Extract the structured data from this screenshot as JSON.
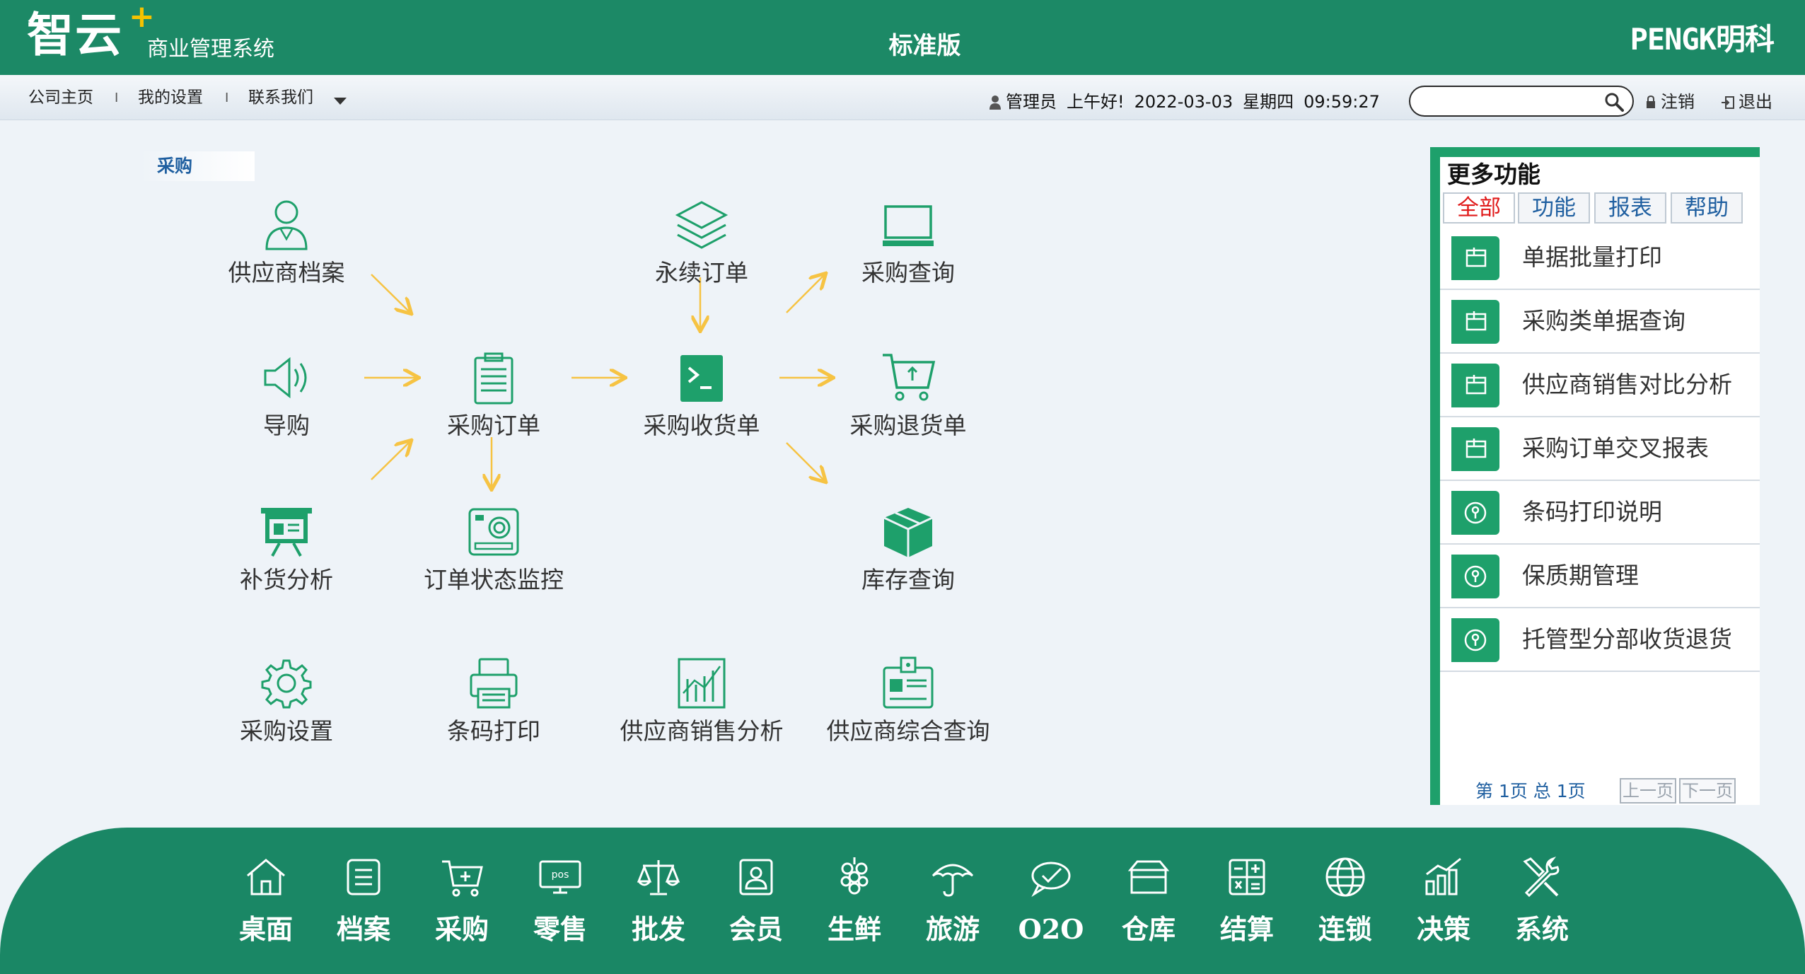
{
  "header": {
    "logo_main": "智云",
    "logo_plus": "+",
    "logo_sub": "商业管理系统",
    "edition": "标准版",
    "brand": "PENGK明科"
  },
  "nav": {
    "links": [
      "公司主页",
      "我的设置",
      "联系我们"
    ],
    "separators": [
      "I",
      "I"
    ],
    "user_role": "管理员",
    "greeting": "上午好!",
    "date": "2022-03-03",
    "weekday": "星期四",
    "time": "09:59:27",
    "search_value": "",
    "logout_label": "注销",
    "exit_label": "退出"
  },
  "section": {
    "title": "采购"
  },
  "flow": {
    "items": [
      {
        "label": "供应商档案",
        "icon": "person-icon"
      },
      {
        "label": "永续订单",
        "icon": "layers-icon"
      },
      {
        "label": "采购查询",
        "icon": "monitor-icon"
      },
      {
        "label": "导购",
        "icon": "speaker-icon"
      },
      {
        "label": "采购订单",
        "icon": "clipboard-icon"
      },
      {
        "label": "采购收货单",
        "icon": "terminal-icon"
      },
      {
        "label": "采购退货单",
        "icon": "cart-return-icon"
      },
      {
        "label": "补货分析",
        "icon": "presentation-icon"
      },
      {
        "label": "订单状态监控",
        "icon": "camera-icon"
      },
      {
        "label": "库存查询",
        "icon": "box-icon"
      },
      {
        "label": "采购设置",
        "icon": "gear-icon"
      },
      {
        "label": "条码打印",
        "icon": "printer-icon"
      },
      {
        "label": "供应商销售分析",
        "icon": "chart-icon"
      },
      {
        "label": "供应商综合查询",
        "icon": "id-card-icon"
      }
    ]
  },
  "more": {
    "title": "更多功能",
    "tabs": [
      "全部",
      "功能",
      "报表",
      "帮助"
    ],
    "active_tab": "全部",
    "items": [
      {
        "label": "单据批量打印",
        "icon": "window-icon"
      },
      {
        "label": "采购类单据查询",
        "icon": "window-icon"
      },
      {
        "label": "供应商销售对比分析",
        "icon": "window-icon"
      },
      {
        "label": "采购订单交叉报表",
        "icon": "window-icon"
      },
      {
        "label": "条码打印说明",
        "icon": "help-icon"
      },
      {
        "label": "保质期管理",
        "icon": "help-icon"
      },
      {
        "label": "托管型分部收货退货",
        "icon": "help-icon"
      }
    ],
    "pager_text": "第 1页 总 1页",
    "prev_label": "上一页",
    "next_label": "下一页"
  },
  "dock": {
    "items": [
      {
        "label": "桌面",
        "icon": "home-icon"
      },
      {
        "label": "档案",
        "icon": "document-icon"
      },
      {
        "label": "采购",
        "icon": "cart-icon"
      },
      {
        "label": "零售",
        "icon": "pos-icon"
      },
      {
        "label": "批发",
        "icon": "scale-icon"
      },
      {
        "label": "会员",
        "icon": "member-icon"
      },
      {
        "label": "生鲜",
        "icon": "grapes-icon"
      },
      {
        "label": "旅游",
        "icon": "umbrella-icon"
      },
      {
        "label": "O2O",
        "icon": "o2o-icon"
      },
      {
        "label": "仓库",
        "icon": "warehouse-icon"
      },
      {
        "label": "结算",
        "icon": "calculator-icon"
      },
      {
        "label": "连锁",
        "icon": "globe-icon"
      },
      {
        "label": "决策",
        "icon": "stats-icon"
      },
      {
        "label": "系统",
        "icon": "tools-icon"
      }
    ]
  },
  "colors": {
    "header_green": "#1c8966",
    "accent_green": "#1ea06b",
    "arrow_yellow": "#f6c343",
    "link_blue": "#1f5fa0",
    "active_red": "#e01a1a"
  }
}
